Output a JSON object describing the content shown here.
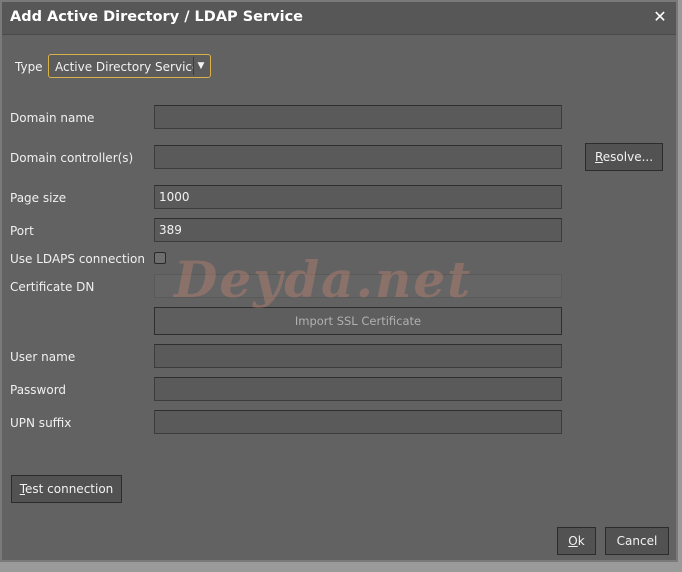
{
  "dialog": {
    "title": "Add Active Directory / LDAP Service",
    "close_glyph": "✕"
  },
  "type": {
    "label": "Type",
    "selected": "Active Directory Service",
    "arrow_glyph": "▼"
  },
  "fields": {
    "domain_name": {
      "label": "Domain name",
      "value": ""
    },
    "domain_controllers": {
      "label": "Domain controller(s)",
      "value": ""
    },
    "page_size": {
      "label": "Page size",
      "value": "1000"
    },
    "port": {
      "label": "Port",
      "value": "389"
    },
    "use_ldaps": {
      "label": "Use LDAPS connection",
      "checked": false
    },
    "certificate_dn": {
      "label": "Certificate DN",
      "value": ""
    },
    "user_name": {
      "label": "User name",
      "value": ""
    },
    "password": {
      "label": "Password",
      "value": ""
    },
    "upn_suffix": {
      "label": "UPN suffix",
      "value": ""
    }
  },
  "buttons": {
    "resolve_mnemonic": "R",
    "resolve_rest": "esolve...",
    "import_ssl": "Import SSL Certificate",
    "test_mnemonic": "T",
    "test_rest": "est connection",
    "ok_mnemonic": "O",
    "ok_rest": "k",
    "cancel": "Cancel"
  },
  "watermark": "Deyda.net",
  "colors": {
    "dialog_bg": "#626262",
    "title_bg": "#575757",
    "select_focus_border": "#d9b24a"
  }
}
